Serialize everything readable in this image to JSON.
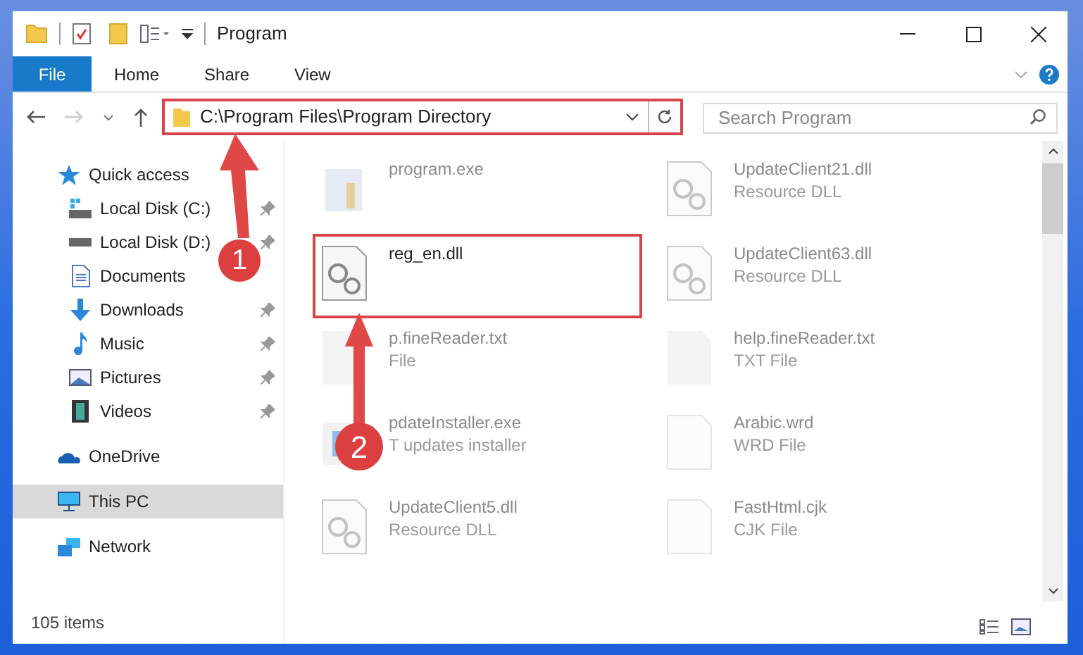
{
  "window": {
    "title": "Program"
  },
  "ribbon_tabs": [
    {
      "label": "File",
      "selected": true
    },
    {
      "label": "Home",
      "selected": false
    },
    {
      "label": "Share",
      "selected": false
    },
    {
      "label": "View",
      "selected": false
    }
  ],
  "address": {
    "path": "C:\\Program Files\\Program Directory",
    "highlighted": true
  },
  "search": {
    "placeholder": "Search Program"
  },
  "sidebar": [
    {
      "label": "Quick access",
      "kind": "star",
      "selected": false,
      "children": [
        {
          "label": "Local Disk (C:)",
          "kind": "system",
          "pinned": true,
          "selected": false
        },
        {
          "label": "Local Disk (D:)",
          "kind": "disk",
          "pinned": true,
          "selected": false
        },
        {
          "label": "Documents",
          "kind": "documents",
          "pinned": false,
          "selected": false
        },
        {
          "label": "Downloads",
          "kind": "downloads",
          "pinned": true,
          "selected": false
        },
        {
          "label": "Music",
          "kind": "music",
          "pinned": true,
          "selected": false
        },
        {
          "label": "Pictures",
          "kind": "pictures",
          "pinned": true,
          "selected": false
        },
        {
          "label": "Videos",
          "kind": "videos",
          "pinned": true,
          "selected": false
        }
      ]
    },
    {
      "label": "OneDrive",
      "kind": "cloud",
      "selected": false
    },
    {
      "label": "This PC",
      "kind": "computer",
      "selected": true
    },
    {
      "label": "Network",
      "kind": "network",
      "selected": false
    }
  ],
  "files": [
    {
      "name": "program.exe",
      "kind": "exe",
      "dimmed": true,
      "highlighted": false
    },
    {
      "name": "UpdateClient21.dll",
      "type": "Resource DLL",
      "kind": "dll",
      "dimmed": true,
      "highlighted": false
    },
    {
      "name": "reg_en.dll",
      "kind": "dll",
      "dimmed": false,
      "highlighted": true
    },
    {
      "name": "UpdateClient63.dll",
      "type": "Resource DLL",
      "kind": "dll",
      "dimmed": true,
      "highlighted": false
    },
    {
      "name": "p.fineReader.txt",
      "type": "File",
      "kind": "txt",
      "dimmed": true,
      "highlighted": false
    },
    {
      "name": "help.fineReader.txt",
      "type": "TXT File",
      "kind": "txt",
      "dimmed": true,
      "highlighted": false
    },
    {
      "name": "pdateInstaller.exe",
      "type": "T updates installer",
      "kind": "installer",
      "dimmed": true,
      "highlighted": false
    },
    {
      "name": "Arabic.wrd",
      "type": "WRD File",
      "kind": "blank",
      "dimmed": true,
      "highlighted": false
    },
    {
      "name": "UpdateClient5.dll",
      "type": "Resource DLL",
      "kind": "dll",
      "dimmed": true,
      "highlighted": false
    },
    {
      "name": "FastHtml.cjk",
      "type": "CJK File",
      "kind": "blank",
      "dimmed": true,
      "highlighted": false
    }
  ],
  "status_bar": {
    "count": "105 items"
  },
  "annotations": [
    {
      "number": "1"
    },
    {
      "number": "2"
    }
  ]
}
